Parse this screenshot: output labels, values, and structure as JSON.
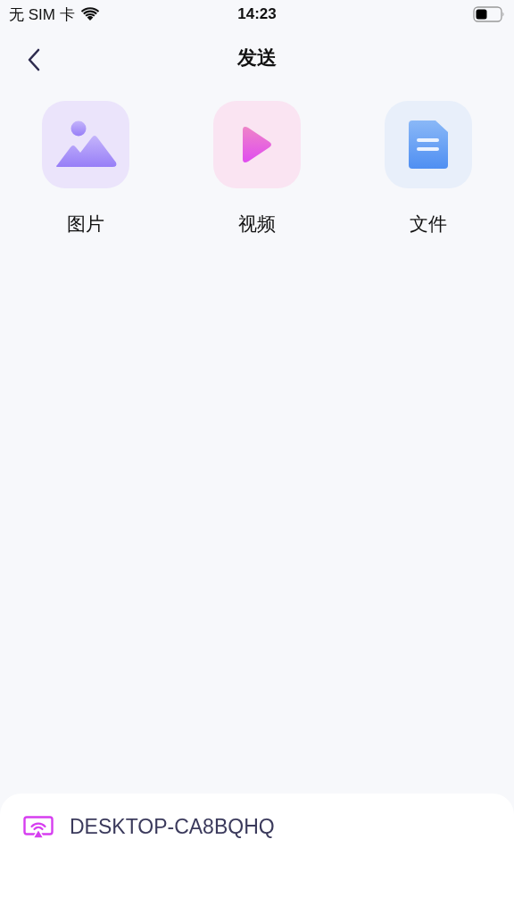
{
  "status_bar": {
    "carrier": "无 SIM 卡",
    "time": "14:23"
  },
  "nav": {
    "title": "发送"
  },
  "options": [
    {
      "kind": "image",
      "label": "图片"
    },
    {
      "kind": "video",
      "label": "视频"
    },
    {
      "kind": "file",
      "label": "文件"
    }
  ],
  "device_sheet": {
    "device": "DESKTOP-CA8BQHQ"
  }
}
